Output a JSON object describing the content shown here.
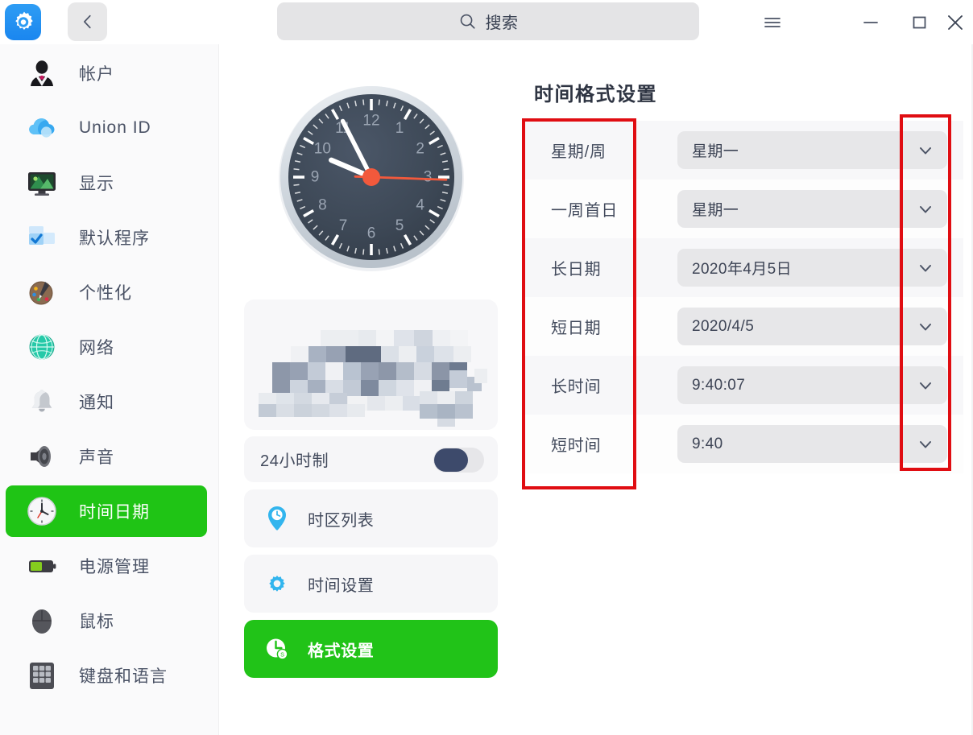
{
  "titlebar": {
    "app_icon": "settings-gear-icon",
    "back_icon": "chevron-left-icon",
    "search_placeholder": "搜索",
    "search_value": "",
    "search_icon": "search-icon",
    "menu_icon": "hamburger-menu-icon",
    "minimize_icon": "minimize-icon",
    "maximize_icon": "maximize-icon",
    "close_icon": "close-icon"
  },
  "sidebar": {
    "items": [
      {
        "label": "帐户",
        "icon": "account-avatar-icon",
        "selected": false
      },
      {
        "label": "Union ID",
        "icon": "cloud-icon",
        "selected": false
      },
      {
        "label": "显示",
        "icon": "monitor-display-icon",
        "selected": false
      },
      {
        "label": "默认程序",
        "icon": "default-apps-icon",
        "selected": false
      },
      {
        "label": "个性化",
        "icon": "palette-icon",
        "selected": false
      },
      {
        "label": "网络",
        "icon": "globe-network-icon",
        "selected": false
      },
      {
        "label": "通知",
        "icon": "bell-icon",
        "selected": false
      },
      {
        "label": "声音",
        "icon": "speaker-icon",
        "selected": false
      },
      {
        "label": "时间日期",
        "icon": "clock-icon",
        "selected": true
      },
      {
        "label": "电源管理",
        "icon": "battery-icon",
        "selected": false
      },
      {
        "label": "鼠标",
        "icon": "mouse-icon",
        "selected": false
      },
      {
        "label": "键盘和语言",
        "icon": "keyboard-icon",
        "selected": false
      }
    ]
  },
  "middle": {
    "clock": {
      "name": "analog-clock",
      "hour_numerals": [
        "12",
        "1",
        "2",
        "3",
        "4",
        "5",
        "6",
        "7",
        "8",
        "9",
        "10",
        "11"
      ],
      "hour_hand_deg": 293,
      "minute_hand_deg": 333,
      "second_hand_deg": 92,
      "face_color": "#3c4757",
      "second_hand_color": "#f05a3c",
      "bezel_color": "#ccd3da"
    },
    "datetime_panel": {
      "name": "blurred-datetime-panel",
      "redacted": true
    },
    "hour24": {
      "label": "24小时制",
      "enabled": false
    },
    "buttons": [
      {
        "label": "时区列表",
        "icon": "location-pin-clock-icon",
        "active": false
      },
      {
        "label": "时间设置",
        "icon": "gear-icon",
        "active": false
      },
      {
        "label": "格式设置",
        "icon": "clock-format-icon",
        "active": true
      }
    ]
  },
  "right": {
    "title": "时间格式设置",
    "rows": [
      {
        "label": "星期/周",
        "value": "星期一"
      },
      {
        "label": "一周首日",
        "value": "星期一"
      },
      {
        "label": "长日期",
        "value": "2020年4月5日"
      },
      {
        "label": "短日期",
        "value": "2020/4/5"
      },
      {
        "label": "长时间",
        "value": "9:40:07"
      },
      {
        "label": "短时间",
        "value": "9:40"
      }
    ],
    "chevron_icon": "chevron-down-icon"
  },
  "annotations": {
    "accent_color": "#e00d12",
    "boxes": [
      {
        "name": "labels-column-highlight"
      },
      {
        "name": "chevron-column-highlight"
      }
    ]
  },
  "colors": {
    "accent_green": "#1fc415",
    "toggle_knob": "#3d4a6b",
    "sidebar_bg": "#fafafb",
    "text": "#434b5d"
  }
}
